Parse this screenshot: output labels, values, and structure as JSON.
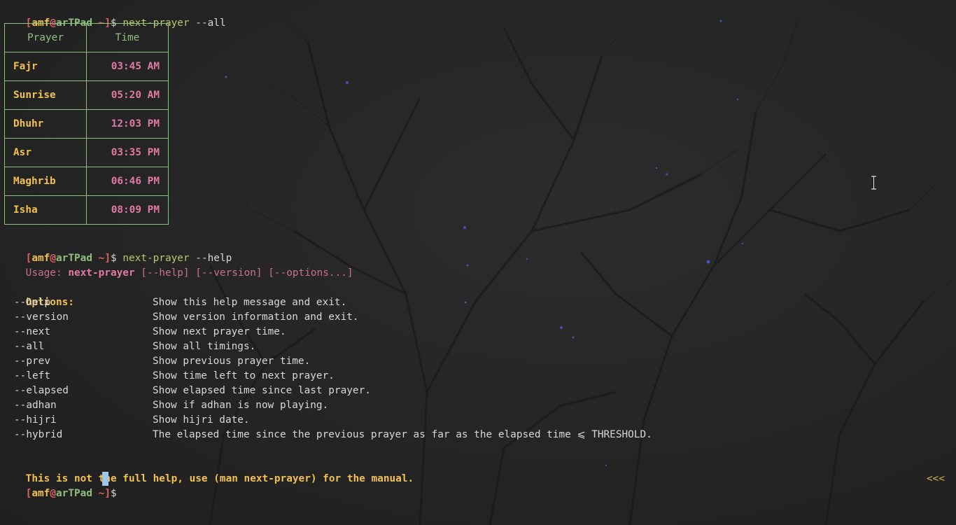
{
  "prompt": {
    "open": "[",
    "user": "amf",
    "at": "@",
    "host": "arTPad",
    "tilde": " ~",
    "close": "]",
    "dollar": "$ "
  },
  "commands": {
    "first": {
      "program": "next-prayer",
      "args": " --all"
    },
    "second": {
      "program": "next-prayer",
      "args": " --help"
    }
  },
  "table": {
    "headers": [
      "Prayer",
      "Time"
    ],
    "rows": [
      {
        "prayer": "Fajr",
        "time": "03:45 AM"
      },
      {
        "prayer": "Sunrise",
        "time": "05:20 AM"
      },
      {
        "prayer": "Dhuhr",
        "time": "12:03 PM"
      },
      {
        "prayer": "Asr",
        "time": "03:35 PM"
      },
      {
        "prayer": "Maghrib",
        "time": "06:46 PM"
      },
      {
        "prayer": "Isha",
        "time": "08:09 PM"
      }
    ]
  },
  "help": {
    "usage_prefix": "Usage: ",
    "usage_program": "next-prayer",
    "usage_rest": " [--help] [--version] [--options...]",
    "options_header": "Options:",
    "options": [
      {
        "flag": "--help",
        "desc": "Show this help message and exit."
      },
      {
        "flag": "--version",
        "desc": "Show version information and exit."
      },
      {
        "flag": "--next",
        "desc": "Show next prayer time."
      },
      {
        "flag": "--all",
        "desc": "Show all timings."
      },
      {
        "flag": "--prev",
        "desc": "Show previous prayer time."
      },
      {
        "flag": "--left",
        "desc": "Show time left to next prayer."
      },
      {
        "flag": "--elapsed",
        "desc": "Show elapsed time since last prayer."
      },
      {
        "flag": "--adhan",
        "desc": "Show if adhan is now playing."
      },
      {
        "flag": "--hijri",
        "desc": "Show hijri date."
      },
      {
        "flag": "--hybrid",
        "desc": "The elapsed time since the previous prayer as far as the elapsed time ⩽ THRESHOLD."
      }
    ],
    "footer": "This is not the full help, use (man next-prayer) for the manual."
  },
  "right_prompt": "<<<",
  "colors": {
    "bracket": "#e06060",
    "user": "#f2c14e",
    "host": "#8fbf7f",
    "command": "#b7c96a",
    "table_border": "#8fbf7f",
    "time": "#e07aa3",
    "cursor": "#9fc7ea"
  },
  "icons": {
    "mouse_cursor": "text-ibeam-icon"
  }
}
